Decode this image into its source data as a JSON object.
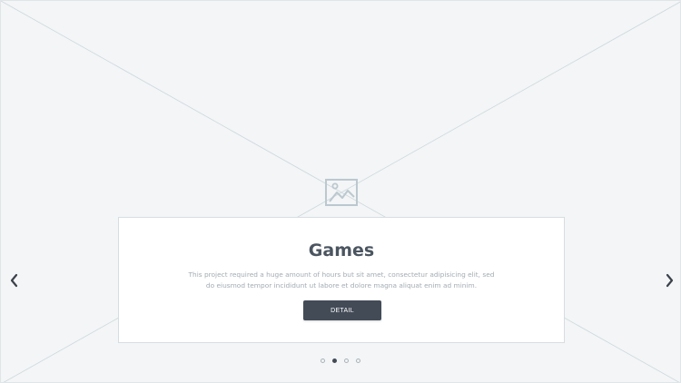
{
  "slide": {
    "title": "Games",
    "description": "This project required a huge amount of hours but  sit amet, consectetur adipisicing elit, sed do eiusmod tempor incididunt ut labore et dolore magna aliquat enim ad minim.",
    "button_label": "DETAIL"
  },
  "navigation": {
    "prev_icon": "chevron-left-icon",
    "next_icon": "chevron-right-icon"
  },
  "pagination": {
    "total": 4,
    "active_index": 1
  },
  "image_placeholder_icon": "image-icon",
  "colors": {
    "background": "#f3f5f6",
    "button": "#434b57",
    "title": "#4b5560",
    "description": "#a3abb2"
  }
}
